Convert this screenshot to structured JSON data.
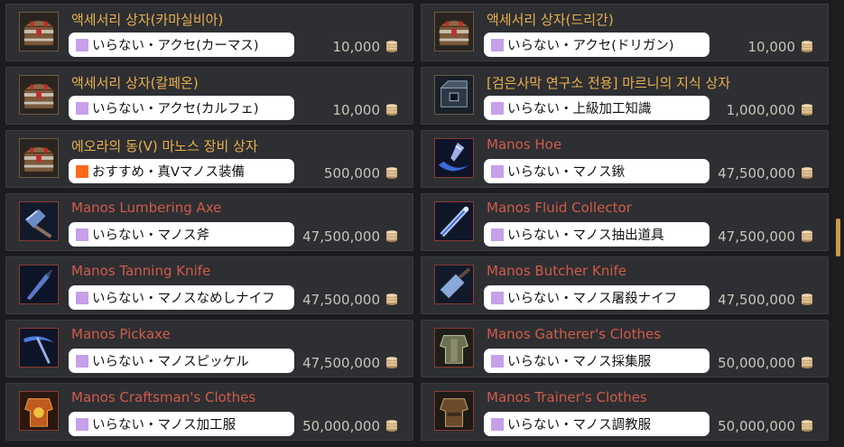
{
  "colors": {
    "gold_title": "#e8b04a",
    "red_title": "#d05a48",
    "recommend_square": "#ff6a1a",
    "unneeded_square": "#c6a0ea"
  },
  "items": [
    {
      "title": "액세서리 상자(카마실비아)",
      "title_color": "gold",
      "icon": "treasure-chest-icon",
      "tag_text": "いらない・アクセ(カーマス)",
      "tag_kind": "unneeded",
      "price": "10,000"
    },
    {
      "title": "액세서리 상자(드리간)",
      "title_color": "gold",
      "icon": "treasure-chest-icon",
      "tag_text": "いらない・アクセ(ドリガン)",
      "tag_kind": "unneeded",
      "price": "10,000"
    },
    {
      "title": "액세서리 상자(칼페온)",
      "title_color": "gold",
      "icon": "treasure-chest-icon",
      "tag_text": "いらない・アクセ(カルフェ)",
      "tag_kind": "unneeded",
      "price": "10,000"
    },
    {
      "title": "[검은사막 연구소 전용] 마르니의 지식 상자",
      "title_color": "gold",
      "icon": "knowledge-box-icon",
      "tag_text": "いらない・上級加工知識",
      "tag_kind": "unneeded",
      "price": "1,000,000"
    },
    {
      "title": "에오라의 동(V) 마노스 장비 상자",
      "title_color": "gold",
      "icon": "treasure-chest-icon",
      "tag_text": "おすすめ・真Vマノス装備",
      "tag_kind": "recommend",
      "price": "500,000"
    },
    {
      "title": "Manos Hoe",
      "title_color": "red",
      "icon": "hoe-icon",
      "tag_text": "いらない・マノス鍬",
      "tag_kind": "unneeded",
      "price": "47,500,000"
    },
    {
      "title": "Manos Lumbering Axe",
      "title_color": "red",
      "icon": "axe-icon",
      "tag_text": "いらない・マノス斧",
      "tag_kind": "unneeded",
      "price": "47,500,000"
    },
    {
      "title": "Manos Fluid Collector",
      "title_color": "red",
      "icon": "fluid-collector-icon",
      "tag_text": "いらない・マノス抽出道具",
      "tag_kind": "unneeded",
      "price": "47,500,000"
    },
    {
      "title": "Manos Tanning Knife",
      "title_color": "red",
      "icon": "tanning-knife-icon",
      "tag_text": "いらない・マノスなめしナイフ",
      "tag_kind": "unneeded",
      "price": "47,500,000"
    },
    {
      "title": "Manos Butcher Knife",
      "title_color": "red",
      "icon": "butcher-knife-icon",
      "tag_text": "いらない・マノス屠殺ナイフ",
      "tag_kind": "unneeded",
      "price": "47,500,000"
    },
    {
      "title": "Manos Pickaxe",
      "title_color": "red",
      "icon": "pickaxe-icon",
      "tag_text": "いらない・マノスピッケル",
      "tag_kind": "unneeded",
      "price": "47,500,000"
    },
    {
      "title": "Manos Gatherer's Clothes",
      "title_color": "red",
      "icon": "gatherer-clothes-icon",
      "tag_text": "いらない・マノス採集服",
      "tag_kind": "unneeded",
      "price": "50,000,000"
    },
    {
      "title": "Manos Craftsman's Clothes",
      "title_color": "red",
      "icon": "craftsman-clothes-icon",
      "tag_text": "いらない・マノス加工服",
      "tag_kind": "unneeded",
      "price": "50,000,000"
    },
    {
      "title": "Manos Trainer's Clothes",
      "title_color": "red",
      "icon": "trainer-clothes-icon",
      "tag_text": "いらない・マノス調教服",
      "tag_kind": "unneeded",
      "price": "50,000,000"
    }
  ]
}
